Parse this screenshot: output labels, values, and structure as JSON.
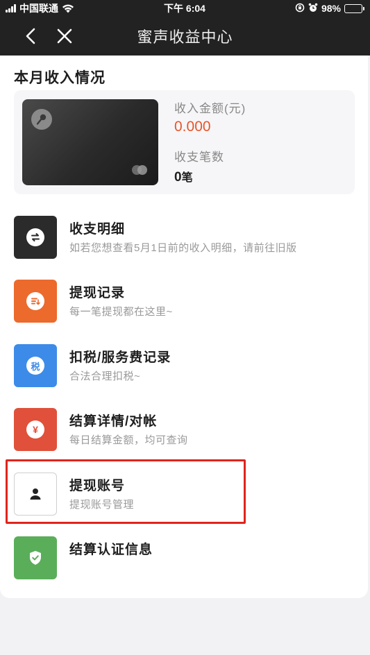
{
  "status_bar": {
    "carrier": "中国联通",
    "time": "下午 6:04",
    "battery": "98%"
  },
  "nav": {
    "title": "蜜声收益中心",
    "back_icon": "chevron-left-icon",
    "close_icon": "close-icon"
  },
  "income": {
    "section_title": "本月收入情况",
    "amount_label": "收入金额(元)",
    "amount_value": "0.000",
    "count_label": "收支笔数",
    "count_value": "0",
    "count_unit": "笔"
  },
  "menu": [
    {
      "title": "收支明细",
      "subtitle": "如若您想查看5月1日前的收入明细，请前往旧版",
      "icon": "swap-icon",
      "color": "#2b2b2b"
    },
    {
      "title": "提现记录",
      "subtitle": "每一笔提现都在这里~",
      "icon": "list-icon",
      "color": "#ec6a2c"
    },
    {
      "title": "扣税/服务费记录",
      "subtitle": "合法合理扣税~",
      "icon": "tax-icon",
      "icon_text": "税",
      "color": "#3d8be8"
    },
    {
      "title": "结算详情/对帐",
      "subtitle": "每日结算金额，均可查询",
      "icon": "yen-icon",
      "icon_text": "¥",
      "color": "#e0503a"
    },
    {
      "title": "提现账号",
      "subtitle": "提现账号管理",
      "icon": "user-icon",
      "color": "#ffffff"
    },
    {
      "title": "结算认证信息",
      "subtitle": "",
      "icon": "shield-check-icon",
      "color": "#5aae5a"
    }
  ],
  "colors": {
    "accent_amount": "#e8552a",
    "highlight_border": "#e0241c"
  }
}
